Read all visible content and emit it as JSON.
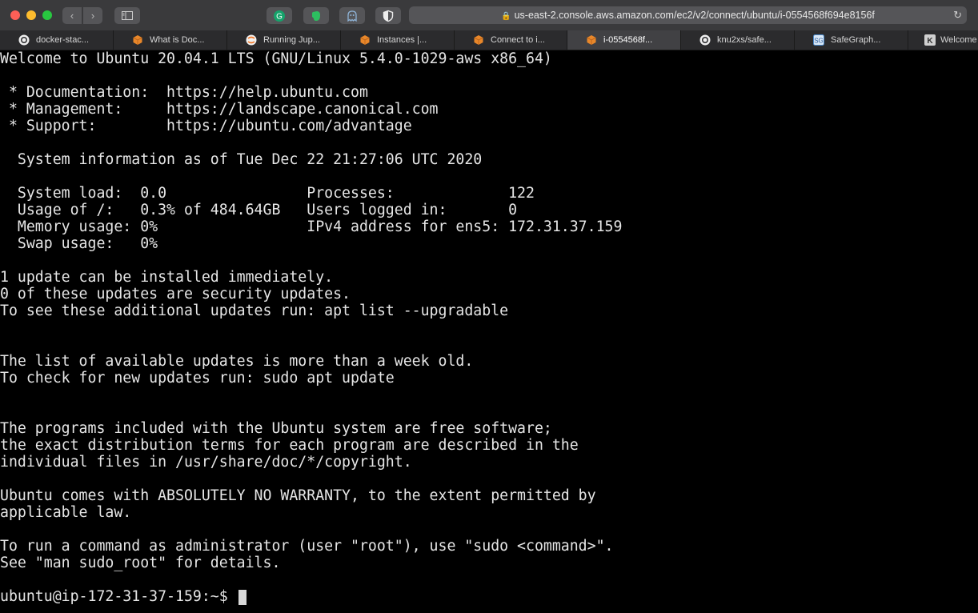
{
  "browser": {
    "url": "us-east-2.console.aws.amazon.com/ec2/v2/connect/ubuntu/i-0554568f694e8156f",
    "tabs": [
      {
        "label": "docker-stac...",
        "icon": "github-icon"
      },
      {
        "label": "What is Doc...",
        "icon": "aws-cube-icon"
      },
      {
        "label": "Running Jup...",
        "icon": "jupyter-icon"
      },
      {
        "label": "Instances |...",
        "icon": "aws-cube-icon"
      },
      {
        "label": "Connect to i...",
        "icon": "aws-cube-icon"
      },
      {
        "label": "i-0554568f...",
        "icon": "aws-cube-icon",
        "active": true
      },
      {
        "label": "knu2xs/safe...",
        "icon": "github-icon"
      },
      {
        "label": "SafeGraph...",
        "icon": "safegraph-icon"
      },
      {
        "label": "Welcome",
        "icon": "k-icon"
      }
    ]
  },
  "terminal": {
    "lines": [
      "Welcome to Ubuntu 20.04.1 LTS (GNU/Linux 5.4.0-1029-aws x86_64)",
      "",
      " * Documentation:  https://help.ubuntu.com",
      " * Management:     https://landscape.canonical.com",
      " * Support:        https://ubuntu.com/advantage",
      "",
      "  System information as of Tue Dec 22 21:27:06 UTC 2020",
      "",
      "  System load:  0.0                Processes:             122",
      "  Usage of /:   0.3% of 484.64GB   Users logged in:       0",
      "  Memory usage: 0%                 IPv4 address for ens5: 172.31.37.159",
      "  Swap usage:   0%",
      "",
      "1 update can be installed immediately.",
      "0 of these updates are security updates.",
      "To see these additional updates run: apt list --upgradable",
      "",
      "",
      "The list of available updates is more than a week old.",
      "To check for new updates run: sudo apt update",
      "",
      "",
      "The programs included with the Ubuntu system are free software;",
      "the exact distribution terms for each program are described in the",
      "individual files in /usr/share/doc/*/copyright.",
      "",
      "Ubuntu comes with ABSOLUTELY NO WARRANTY, to the extent permitted by",
      "applicable law.",
      "",
      "To run a command as administrator (user \"root\"), use \"sudo <command>\".",
      "See \"man sudo_root\" for details.",
      "",
      "ubuntu@ip-172-31-37-159:~$ "
    ]
  },
  "colors": {
    "toolbar": "#3a3a3c",
    "terminal_bg": "#000000",
    "terminal_fg": "#e6e6e6",
    "aws_orange": "#e8872a"
  }
}
